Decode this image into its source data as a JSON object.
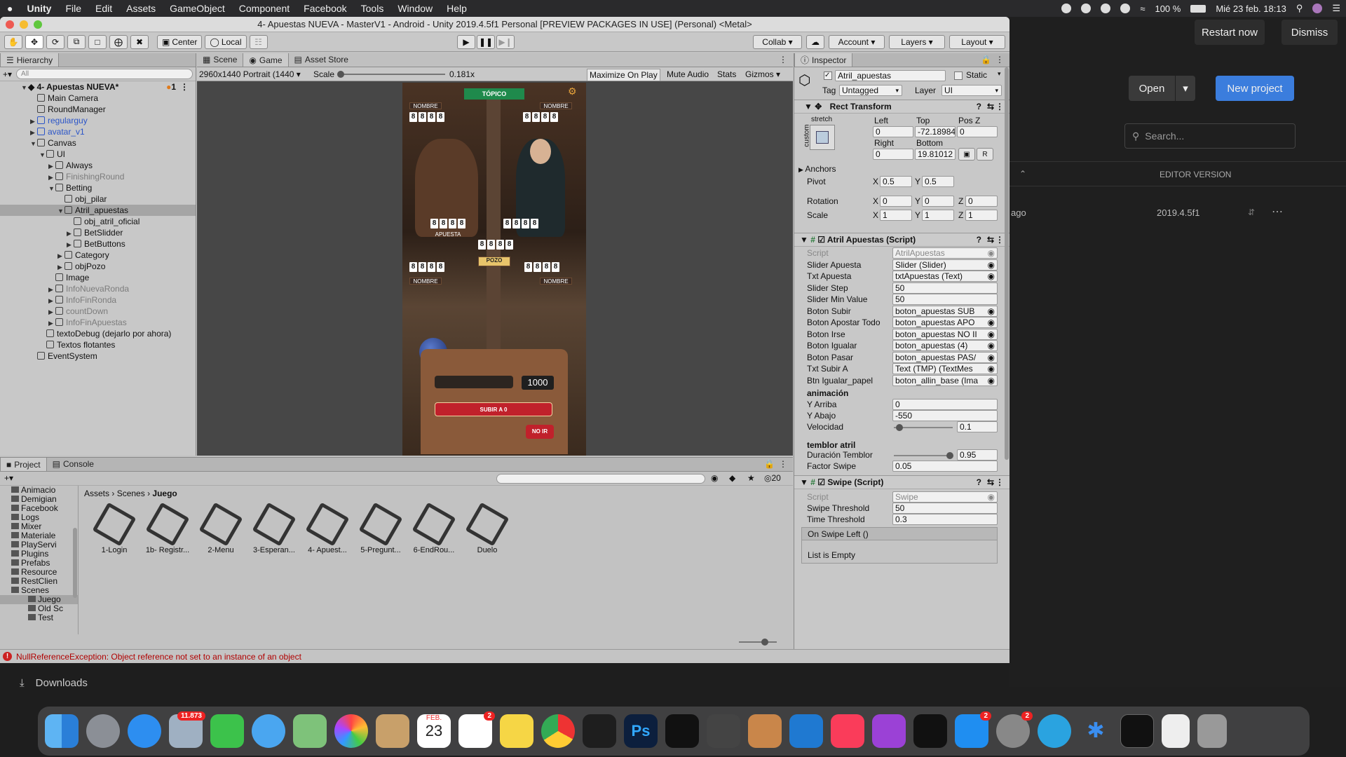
{
  "menubar": {
    "apple": "",
    "app": "Unity",
    "items": [
      "File",
      "Edit",
      "Assets",
      "GameObject",
      "Component",
      "Facebook",
      "Tools",
      "Window",
      "Help"
    ],
    "battery": "100 %",
    "datetime": "Mié 23 feb.  18:13"
  },
  "hub": {
    "restart": "Restart now",
    "dismiss": "Dismiss",
    "open": "Open",
    "new_project": "New project",
    "search_placeholder": "Search...",
    "col_editor": "EDITOR VERSION",
    "row_modified": "ago",
    "row_version": "2019.4.5f1"
  },
  "downloads": "Downloads",
  "window": {
    "title": "4- Apuestas NUEVA - MasterV1 - Android - Unity 2019.4.5f1 Personal [PREVIEW PACKAGES IN USE] (Personal) <Metal>"
  },
  "toolbar": {
    "center": "Center",
    "local": "Local",
    "collab": "Collab",
    "account": "Account",
    "layers": "Layers",
    "layout": "Layout"
  },
  "hierarchy": {
    "tab": "Hierarchy",
    "search_placeholder": "All",
    "scene": "4- Apuestas NUEVA*",
    "scene_count": "1",
    "rows": [
      {
        "label": "Main Camera",
        "indent": 1,
        "arrow": "",
        "style": ""
      },
      {
        "label": "RoundManager",
        "indent": 1,
        "arrow": "",
        "style": ""
      },
      {
        "label": "regularguy",
        "indent": 1,
        "arrow": "▶",
        "style": "blue"
      },
      {
        "label": "avatar_v1",
        "indent": 1,
        "arrow": "▶",
        "style": "blue"
      },
      {
        "label": "Canvas",
        "indent": 1,
        "arrow": "▼",
        "style": ""
      },
      {
        "label": "UI",
        "indent": 2,
        "arrow": "▼",
        "style": ""
      },
      {
        "label": "Always",
        "indent": 3,
        "arrow": "▶",
        "style": ""
      },
      {
        "label": "FinishingRound",
        "indent": 3,
        "arrow": "▶",
        "style": "grey"
      },
      {
        "label": "Betting",
        "indent": 3,
        "arrow": "▼",
        "style": ""
      },
      {
        "label": "obj_pilar",
        "indent": 4,
        "arrow": "",
        "style": ""
      },
      {
        "label": "Atril_apuestas",
        "indent": 4,
        "arrow": "▼",
        "style": "sel"
      },
      {
        "label": "obj_atril_oficial",
        "indent": 5,
        "arrow": "",
        "style": ""
      },
      {
        "label": "BetSlidder",
        "indent": 5,
        "arrow": "▶",
        "style": ""
      },
      {
        "label": "BetButtons",
        "indent": 5,
        "arrow": "▶",
        "style": ""
      },
      {
        "label": "Category",
        "indent": 4,
        "arrow": "▶",
        "style": ""
      },
      {
        "label": "objPozo",
        "indent": 4,
        "arrow": "▶",
        "style": ""
      },
      {
        "label": "Image",
        "indent": 3,
        "arrow": "",
        "style": ""
      },
      {
        "label": "InfoNuevaRonda",
        "indent": 3,
        "arrow": "▶",
        "style": "grey"
      },
      {
        "label": "InfoFinRonda",
        "indent": 3,
        "arrow": "▶",
        "style": "grey"
      },
      {
        "label": "countDown",
        "indent": 3,
        "arrow": "▶",
        "style": "grey"
      },
      {
        "label": "InfoFinApuestas",
        "indent": 3,
        "arrow": "▶",
        "style": "grey"
      },
      {
        "label": "textoDebug (dejarlo por ahora)",
        "indent": 2,
        "arrow": "",
        "style": ""
      },
      {
        "label": "Textos flotantes",
        "indent": 2,
        "arrow": "",
        "style": ""
      },
      {
        "label": "EventSystem",
        "indent": 1,
        "arrow": "",
        "style": ""
      }
    ]
  },
  "game": {
    "tab_scene": "Scene",
    "tab_game": "Game",
    "tab_store": "Asset Store",
    "resolution": "2960x1440 Portrait (1440",
    "scale_label": "Scale",
    "scale_value": "0.181x",
    "maximize": "Maximize On Play",
    "mute": "Mute Audio",
    "stats": "Stats",
    "gizmos": "Gizmos",
    "topico": "TÓPICO",
    "nombre": "NOMBRE",
    "apuesta": "APUESTA",
    "pozo": "POZO",
    "digit": "8",
    "amount": "1000",
    "subir": "SUBIR A 0",
    "noir": "NO IR"
  },
  "inspector": {
    "tab": "Inspector",
    "object_name": "Atril_apuestas",
    "static": "Static",
    "tag_label": "Tag",
    "tag": "Untagged",
    "layer_label": "Layer",
    "layer": "UI",
    "rect": {
      "title": "Rect Transform",
      "stretch": "stretch",
      "custom": "custom",
      "left_l": "Left",
      "top_l": "Top",
      "posz_l": "Pos Z",
      "left": "0",
      "top": "-72.18984",
      "posz": "0",
      "right_l": "Right",
      "bottom_l": "Bottom",
      "right": "0",
      "bottom": "19.81012",
      "r_btn": "R",
      "anchors": "Anchors",
      "pivot": "Pivot",
      "pivot_x": "0.5",
      "pivot_y": "0.5",
      "rotation": "Rotation",
      "rot_x": "0",
      "rot_y": "0",
      "rot_z": "0",
      "scale": "Scale",
      "sc_x": "1",
      "sc_y": "1",
      "sc_z": "1",
      "x": "X",
      "y": "Y",
      "z": "Z"
    },
    "atril": {
      "title": "Atril Apuestas (Script)",
      "fields": [
        {
          "label": "Script",
          "value": "AtrilApuestas",
          "grey": true
        },
        {
          "label": "Slider Apuesta",
          "value": "Slider (Slider)"
        },
        {
          "label": "Txt Apuesta",
          "value": "txtApuestas (Text)"
        },
        {
          "label": "Slider Step",
          "value": "50"
        },
        {
          "label": "Slider Min Value",
          "value": "50"
        },
        {
          "label": "Boton Subir",
          "value": "boton_apuestas SUB"
        },
        {
          "label": "Boton Apostar Todo",
          "value": "boton_apuestas APO"
        },
        {
          "label": "Boton Irse",
          "value": "boton_apuestas NO II"
        },
        {
          "label": "Boton Igualar",
          "value": "boton_apuestas (4)"
        },
        {
          "label": "Boton Pasar",
          "value": "boton_apuestas PAS/"
        },
        {
          "label": "Txt Subir A",
          "value": "Text (TMP) (TextMes"
        },
        {
          "label": "Btn Igualar_papel",
          "value": "boton_allin_base (Ima"
        }
      ],
      "anim_header": "animación",
      "y_arriba_l": "Y Arriba",
      "y_arriba": "0",
      "y_abajo_l": "Y Abajo",
      "y_abajo": "-550",
      "velocidad_l": "Velocidad",
      "velocidad": "0.1",
      "velocidad_frac": 0.1,
      "temblor_header": "temblor atril",
      "duracion_l": "Duración Temblor",
      "duracion": "0.95",
      "duracion_frac": 0.95,
      "factor_l": "Factor Swipe",
      "factor": "0.05"
    },
    "swipe": {
      "title": "Swipe (Script)",
      "script_l": "Script",
      "script": "Swipe",
      "threshold_l": "Swipe Threshold",
      "threshold": "50",
      "time_l": "Time Threshold",
      "time": "0.3",
      "event": "On Swipe Left ()",
      "empty": "List is Empty"
    }
  },
  "project": {
    "tab": "Project",
    "console": "Console",
    "badge": "20",
    "breadcrumb": [
      "Assets",
      "Scenes",
      "Juego"
    ],
    "folders": [
      {
        "label": "Animacio",
        "indent": 1
      },
      {
        "label": "Demigian",
        "indent": 1
      },
      {
        "label": "Facebook",
        "indent": 1
      },
      {
        "label": "Logs",
        "indent": 1
      },
      {
        "label": "Mixer",
        "indent": 1
      },
      {
        "label": "Materiale",
        "indent": 1
      },
      {
        "label": "PlayServi",
        "indent": 1
      },
      {
        "label": "Plugins",
        "indent": 1
      },
      {
        "label": "Prefabs",
        "indent": 1
      },
      {
        "label": "Resource",
        "indent": 1
      },
      {
        "label": "RestClien",
        "indent": 1
      },
      {
        "label": "Scenes",
        "indent": 1
      },
      {
        "label": "Juego",
        "indent": 2
      },
      {
        "label": "Old Sc",
        "indent": 2
      },
      {
        "label": "Test",
        "indent": 2
      }
    ],
    "assets": [
      "1-Login",
      "1b- Registr...",
      "2-Menu",
      "3-Esperan...",
      "4- Apuest...",
      "5-Pregunt...",
      "6-EndRou...",
      "Duelo"
    ]
  },
  "status": {
    "message": "NullReferenceException: Object reference not set to an instance of an object"
  },
  "dock": {
    "mail_badge": "11.873",
    "calendar_month": "FEB.",
    "calendar_day": "23",
    "reminders_badge": "2",
    "appstore_badge": "2",
    "prefs_badge": "2"
  }
}
